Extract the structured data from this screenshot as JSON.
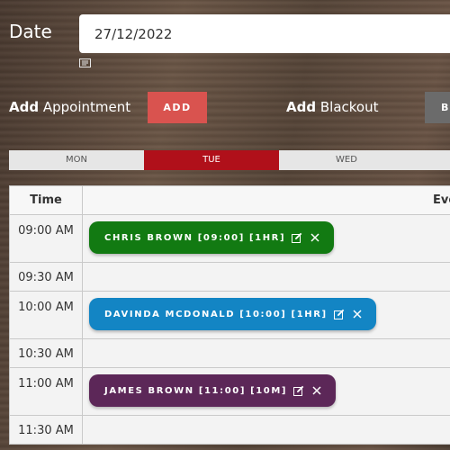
{
  "date": {
    "label": "Date",
    "value": "27/12/2022"
  },
  "add_appointment": {
    "label_bold": "Add",
    "label_rest": " Appointment",
    "button_label": "ADD",
    "button_color": "#d9534f"
  },
  "add_blackout": {
    "label_bold": "Add",
    "label_rest": " Blackout",
    "button_label": "B"
  },
  "day_tabs": [
    {
      "label": "MON",
      "active": false
    },
    {
      "label": "TUE",
      "active": true
    },
    {
      "label": "WED",
      "active": false
    }
  ],
  "colors": {
    "active_tab": "#b0101a",
    "appt_green": "#127a12",
    "appt_blue": "#1385c4",
    "appt_purple": "#5c2758"
  },
  "schedule": {
    "headers": {
      "time": "Time",
      "events": "Eve"
    },
    "slots": [
      {
        "time": "09:00 AM",
        "appointment": {
          "text": "CHRIS BROWN [09:00] [1HR]",
          "color": "#127a12"
        }
      },
      {
        "time": "09:30 AM"
      },
      {
        "time": "10:00 AM",
        "appointment": {
          "text": "DAVINDA MCDONALD [10:00] [1HR]",
          "color": "#1385c4"
        }
      },
      {
        "time": "10:30 AM"
      },
      {
        "time": "11:00 AM",
        "appointment": {
          "text": "JAMES BROWN [11:00] [10M]",
          "color": "#5c2758"
        }
      },
      {
        "time": "11:30 AM"
      }
    ]
  },
  "icons": {
    "calendar": "calendar-icon",
    "edit": "edit-icon",
    "close": "close-icon"
  }
}
